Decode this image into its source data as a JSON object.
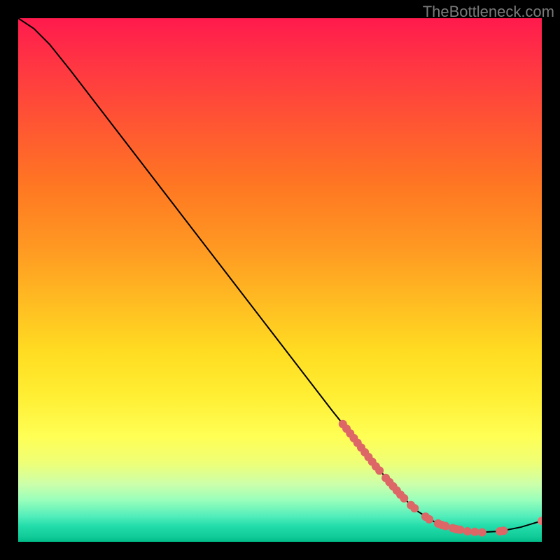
{
  "attribution": "TheBottleneck.com",
  "chart_data": {
    "type": "line",
    "title": "",
    "xlabel": "",
    "ylabel": "",
    "xlim": [
      0,
      100
    ],
    "ylim": [
      0,
      100
    ],
    "curve": [
      {
        "x": 0,
        "y": 100
      },
      {
        "x": 3,
        "y": 98
      },
      {
        "x": 6,
        "y": 95
      },
      {
        "x": 10,
        "y": 90
      },
      {
        "x": 20,
        "y": 77
      },
      {
        "x": 30,
        "y": 64
      },
      {
        "x": 40,
        "y": 51
      },
      {
        "x": 50,
        "y": 38
      },
      {
        "x": 60,
        "y": 25
      },
      {
        "x": 68,
        "y": 15
      },
      {
        "x": 72,
        "y": 10
      },
      {
        "x": 76,
        "y": 6
      },
      {
        "x": 80,
        "y": 3.5
      },
      {
        "x": 84,
        "y": 2.2
      },
      {
        "x": 88,
        "y": 1.8
      },
      {
        "x": 92,
        "y": 2
      },
      {
        "x": 96,
        "y": 2.8
      },
      {
        "x": 100,
        "y": 4
      }
    ],
    "markers": [
      {
        "x": 62,
        "y": 22.5
      },
      {
        "x": 62.7,
        "y": 21.6
      },
      {
        "x": 63.4,
        "y": 20.7
      },
      {
        "x": 64.1,
        "y": 19.8
      },
      {
        "x": 64.8,
        "y": 18.9
      },
      {
        "x": 65.5,
        "y": 18
      },
      {
        "x": 66.2,
        "y": 17.1
      },
      {
        "x": 66.9,
        "y": 16.2
      },
      {
        "x": 67.6,
        "y": 15.3
      },
      {
        "x": 68.3,
        "y": 14.4
      },
      {
        "x": 69,
        "y": 13.6
      },
      {
        "x": 70.2,
        "y": 12.2
      },
      {
        "x": 70.9,
        "y": 11.4
      },
      {
        "x": 71.6,
        "y": 10.6
      },
      {
        "x": 72.3,
        "y": 9.8
      },
      {
        "x": 73,
        "y": 9
      },
      {
        "x": 73.7,
        "y": 8.3
      },
      {
        "x": 75,
        "y": 7
      },
      {
        "x": 75.7,
        "y": 6.4
      },
      {
        "x": 77.8,
        "y": 4.8
      },
      {
        "x": 78.5,
        "y": 4.3
      },
      {
        "x": 80.2,
        "y": 3.5
      },
      {
        "x": 80.9,
        "y": 3.2
      },
      {
        "x": 81.6,
        "y": 3
      },
      {
        "x": 83,
        "y": 2.6
      },
      {
        "x": 83.7,
        "y": 2.4
      },
      {
        "x": 84.4,
        "y": 2.3
      },
      {
        "x": 85.8,
        "y": 2
      },
      {
        "x": 87.2,
        "y": 1.9
      },
      {
        "x": 88.6,
        "y": 1.8
      },
      {
        "x": 92,
        "y": 2
      },
      {
        "x": 92.7,
        "y": 2.1
      }
    ],
    "marker_end": {
      "x": 100,
      "y": 4
    }
  },
  "colors": {
    "background": "#000000",
    "curve": "#000000",
    "marker": "#d66666",
    "attribution": "#7a7a7a"
  }
}
